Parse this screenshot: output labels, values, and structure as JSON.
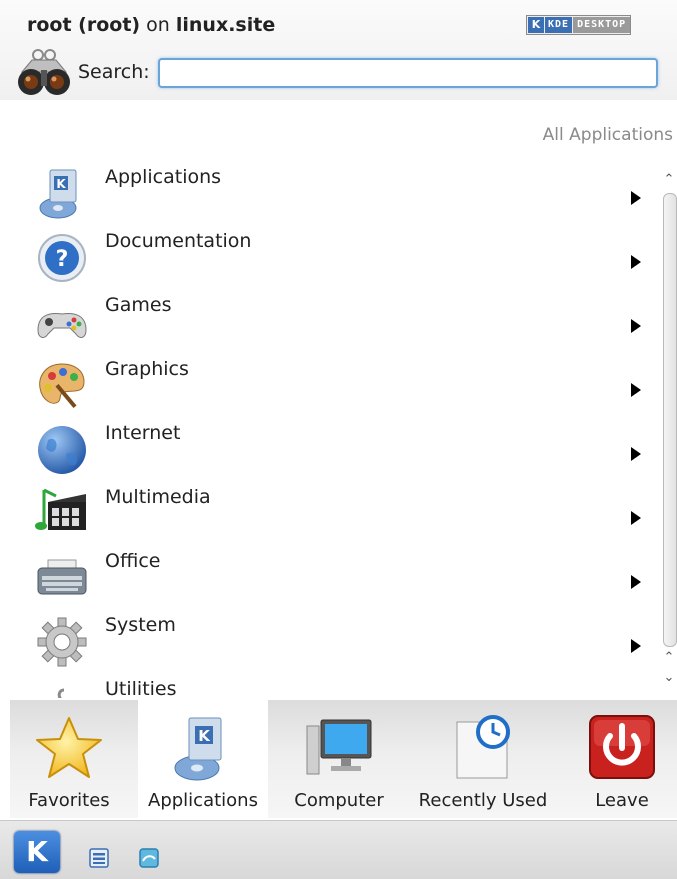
{
  "header": {
    "user_bold": "root (root)",
    "user_on": " on ",
    "host": "linux.site",
    "badge_left": "KDE",
    "badge_right": "DESKTOP",
    "search_label": "Search:",
    "search_value": "",
    "search_placeholder": ""
  },
  "breadcrumb": "All Applications",
  "categories": [
    {
      "label": "Applications",
      "icon": "applications-icon"
    },
    {
      "label": "Documentation",
      "icon": "help-icon"
    },
    {
      "label": "Games",
      "icon": "gamepad-icon"
    },
    {
      "label": "Graphics",
      "icon": "palette-icon"
    },
    {
      "label": "Internet",
      "icon": "globe-icon"
    },
    {
      "label": "Multimedia",
      "icon": "multimedia-icon"
    },
    {
      "label": "Office",
      "icon": "typewriter-icon"
    },
    {
      "label": "System",
      "icon": "gear-icon"
    },
    {
      "label": "Utilities",
      "icon": "utilities-icon"
    }
  ],
  "tabs": [
    {
      "label": "Favorites",
      "icon": "star-icon",
      "active": false
    },
    {
      "label": "Applications",
      "icon": "applications-icon",
      "active": true
    },
    {
      "label": "Computer",
      "icon": "monitor-icon",
      "active": false
    },
    {
      "label": "Recently Used",
      "icon": "clock-document-icon",
      "active": false
    },
    {
      "label": "Leave",
      "icon": "power-icon",
      "active": false
    }
  ],
  "taskbar": {
    "kmenu_label": "K",
    "icons": [
      "task-manager-icon",
      "desktop-icon"
    ]
  },
  "colors": {
    "accent": "#3b6fb4",
    "search_border": "#6aa4d8",
    "leave_red": "#c8211e",
    "star_yellow": "#f5c518"
  }
}
